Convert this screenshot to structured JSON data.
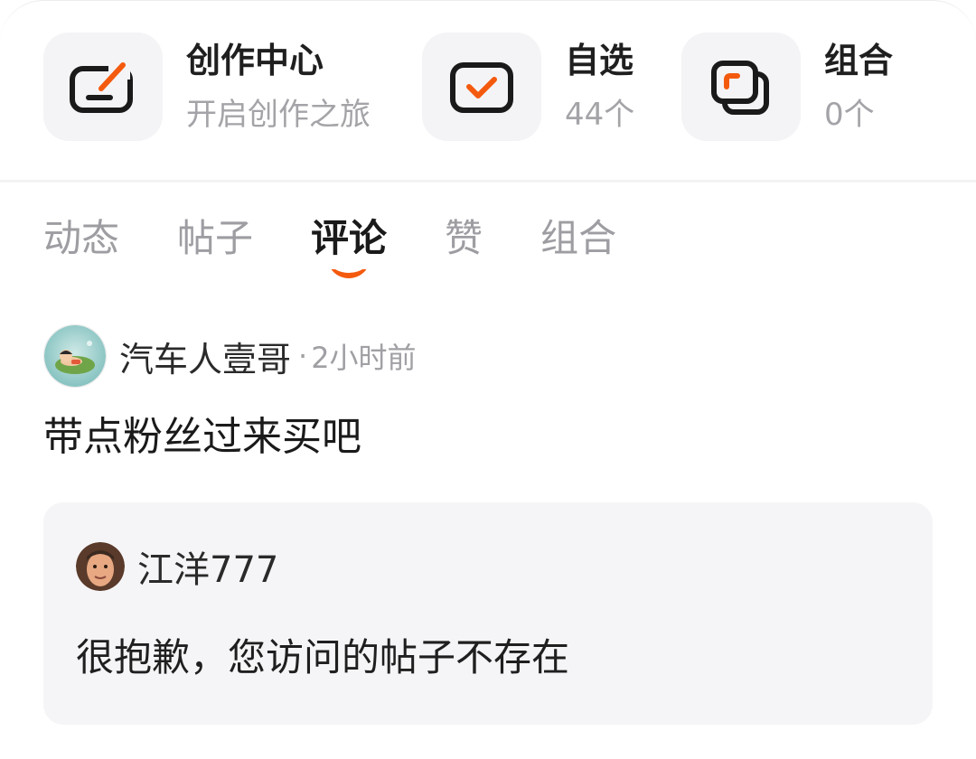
{
  "shortcuts": [
    {
      "title": "创作中心",
      "sub": "开启创作之旅",
      "icon": "pen-square-icon"
    },
    {
      "title": "自选",
      "sub": "44个",
      "icon": "check-square-icon"
    },
    {
      "title": "组合",
      "sub": "0个",
      "icon": "stacked-squares-icon"
    }
  ],
  "tabs": [
    "动态",
    "帖子",
    "评论",
    "赞",
    "组合"
  ],
  "active_tab": "评论",
  "comment": {
    "author": "汽车人壹哥",
    "separator": "·",
    "time": "2小时前",
    "text": "带点粉丝过来买吧"
  },
  "quoted": {
    "author": "江洋777",
    "text": "很抱歉，您访问的帖子不存在"
  },
  "colors": {
    "accent": "#f45a0e",
    "muted": "#a4a4a8",
    "tile_bg": "#f4f4f6",
    "quote_bg": "#f5f5f7"
  }
}
